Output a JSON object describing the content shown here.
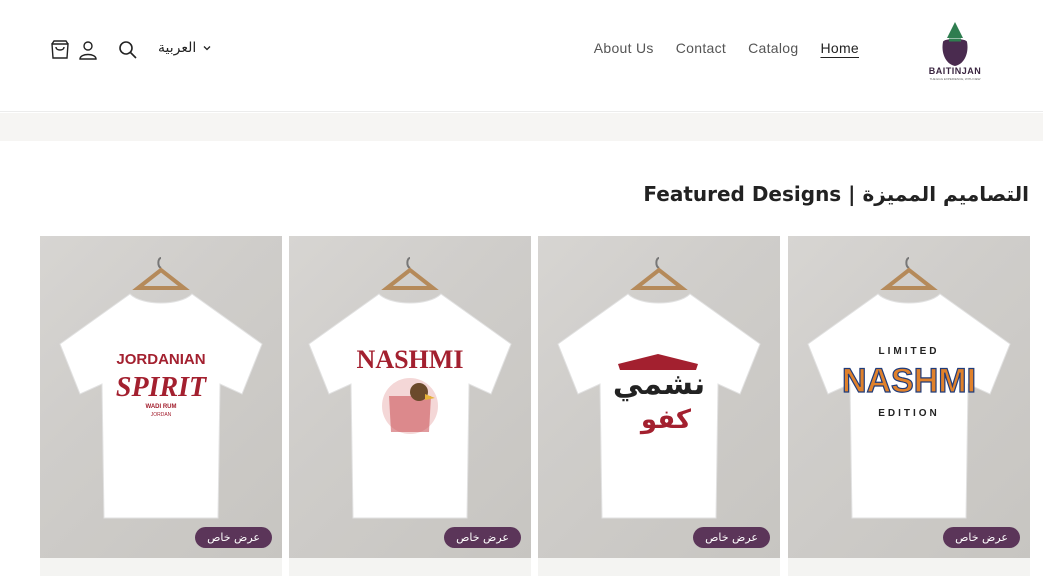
{
  "header": {
    "language": "العربية",
    "nav": [
      "About Us",
      "Contact",
      "Catalog",
      "Home"
    ],
    "active_nav": "Home",
    "logo_text": "BAITINJAN",
    "logo_sub": "THE EGG EXPERIENCE, WITH NEW",
    "icons": [
      "cart-icon",
      "account-icon",
      "search-icon",
      "chevron-down-icon"
    ]
  },
  "featured": {
    "title": "Featured Designs | التصاميم المميزة",
    "products": [
      {
        "design_line1": "JORDANIAN",
        "design_line2": "SPIRIT",
        "design_line3": "WADI RUM",
        "design_line4": "JORDAN",
        "badge": "عرض خاص"
      },
      {
        "design_line1": "NASHMI",
        "badge": "عرض خاص"
      },
      {
        "design_line1": "نشمي",
        "design_line2": "كفو",
        "badge": "عرض خاص"
      },
      {
        "design_line1": "LIMITED",
        "design_line2": "NASHMI",
        "design_line3": "EDITION",
        "badge": "عرض خاص"
      }
    ]
  },
  "colors": {
    "accent": "#5b3559",
    "brand_green": "#2e7d4f",
    "brand_purple": "#4a2b4f",
    "design_red": "#a3202f"
  }
}
